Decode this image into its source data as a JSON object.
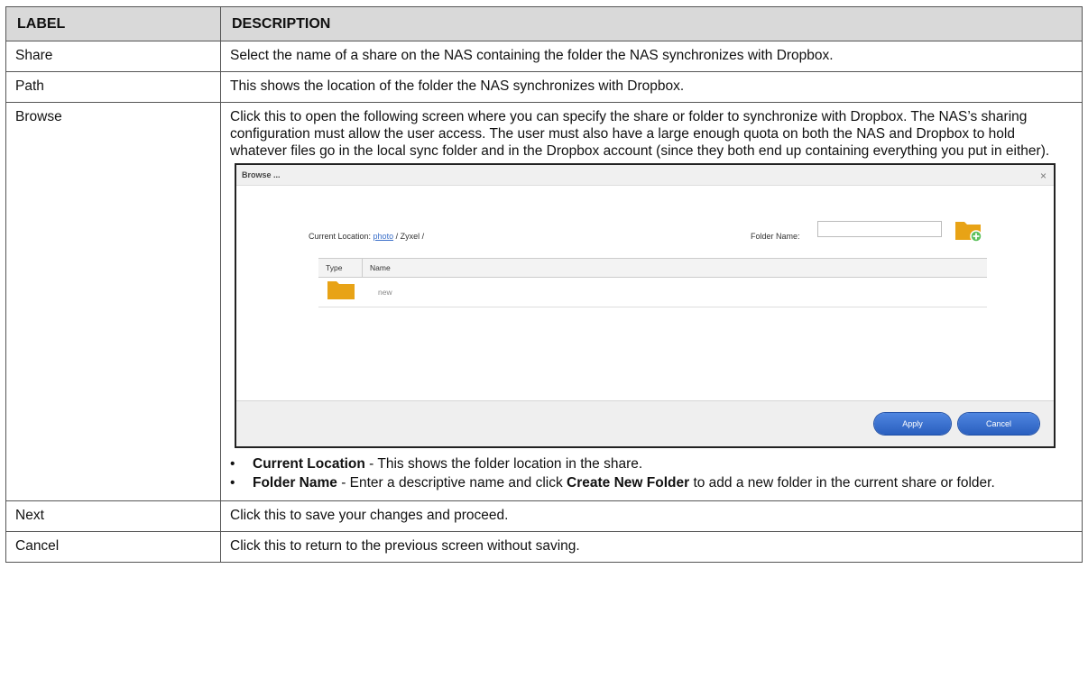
{
  "table": {
    "headers": {
      "label": "LABEL",
      "description": "DESCRIPTION"
    },
    "rows": [
      {
        "label": "Share",
        "description": "Select the name of a share on the NAS containing the folder the NAS synchronizes with Dropbox."
      },
      {
        "label": "Path",
        "description": "This shows the location of the folder the NAS synchronizes with Dropbox."
      },
      {
        "label": "Browse",
        "description": "Click this to open the following screen where you can specify the share or folder to synchronize with Dropbox. The NAS’s sharing configuration must allow the user access. The user must also have a large enough quota on both the NAS and Dropbox to hold whatever files go in the local sync folder and in the Dropbox account (since they both end up containing everything you put in either)."
      },
      {
        "label": "Next",
        "description": "Click this to save your changes and proceed."
      },
      {
        "label": "Cancel",
        "description": "Click this to return to the previous screen without saving."
      }
    ]
  },
  "browse_bullets": [
    {
      "term": "Current Location",
      "text": " - This shows the folder location in the share."
    },
    {
      "term": "Folder Name",
      "text": " - Enter a descriptive name and click ",
      "term2": "Create New Folder",
      "text2": " to add a new folder in the current share or folder."
    }
  ],
  "dialog": {
    "title": "Browse ...",
    "close": "×",
    "current_location_label": "Current Location: ",
    "current_location_link": "photo",
    "current_location_rest": " / Zyxel /",
    "folder_name_label": "Folder Name:",
    "folder_name_value": "",
    "columns": {
      "type": "Type",
      "name": "Name"
    },
    "rows": [
      {
        "name": "new"
      }
    ],
    "apply": "Apply",
    "cancel": "Cancel",
    "folder_color": "#e8a316",
    "add_color": "#5cc05c"
  }
}
